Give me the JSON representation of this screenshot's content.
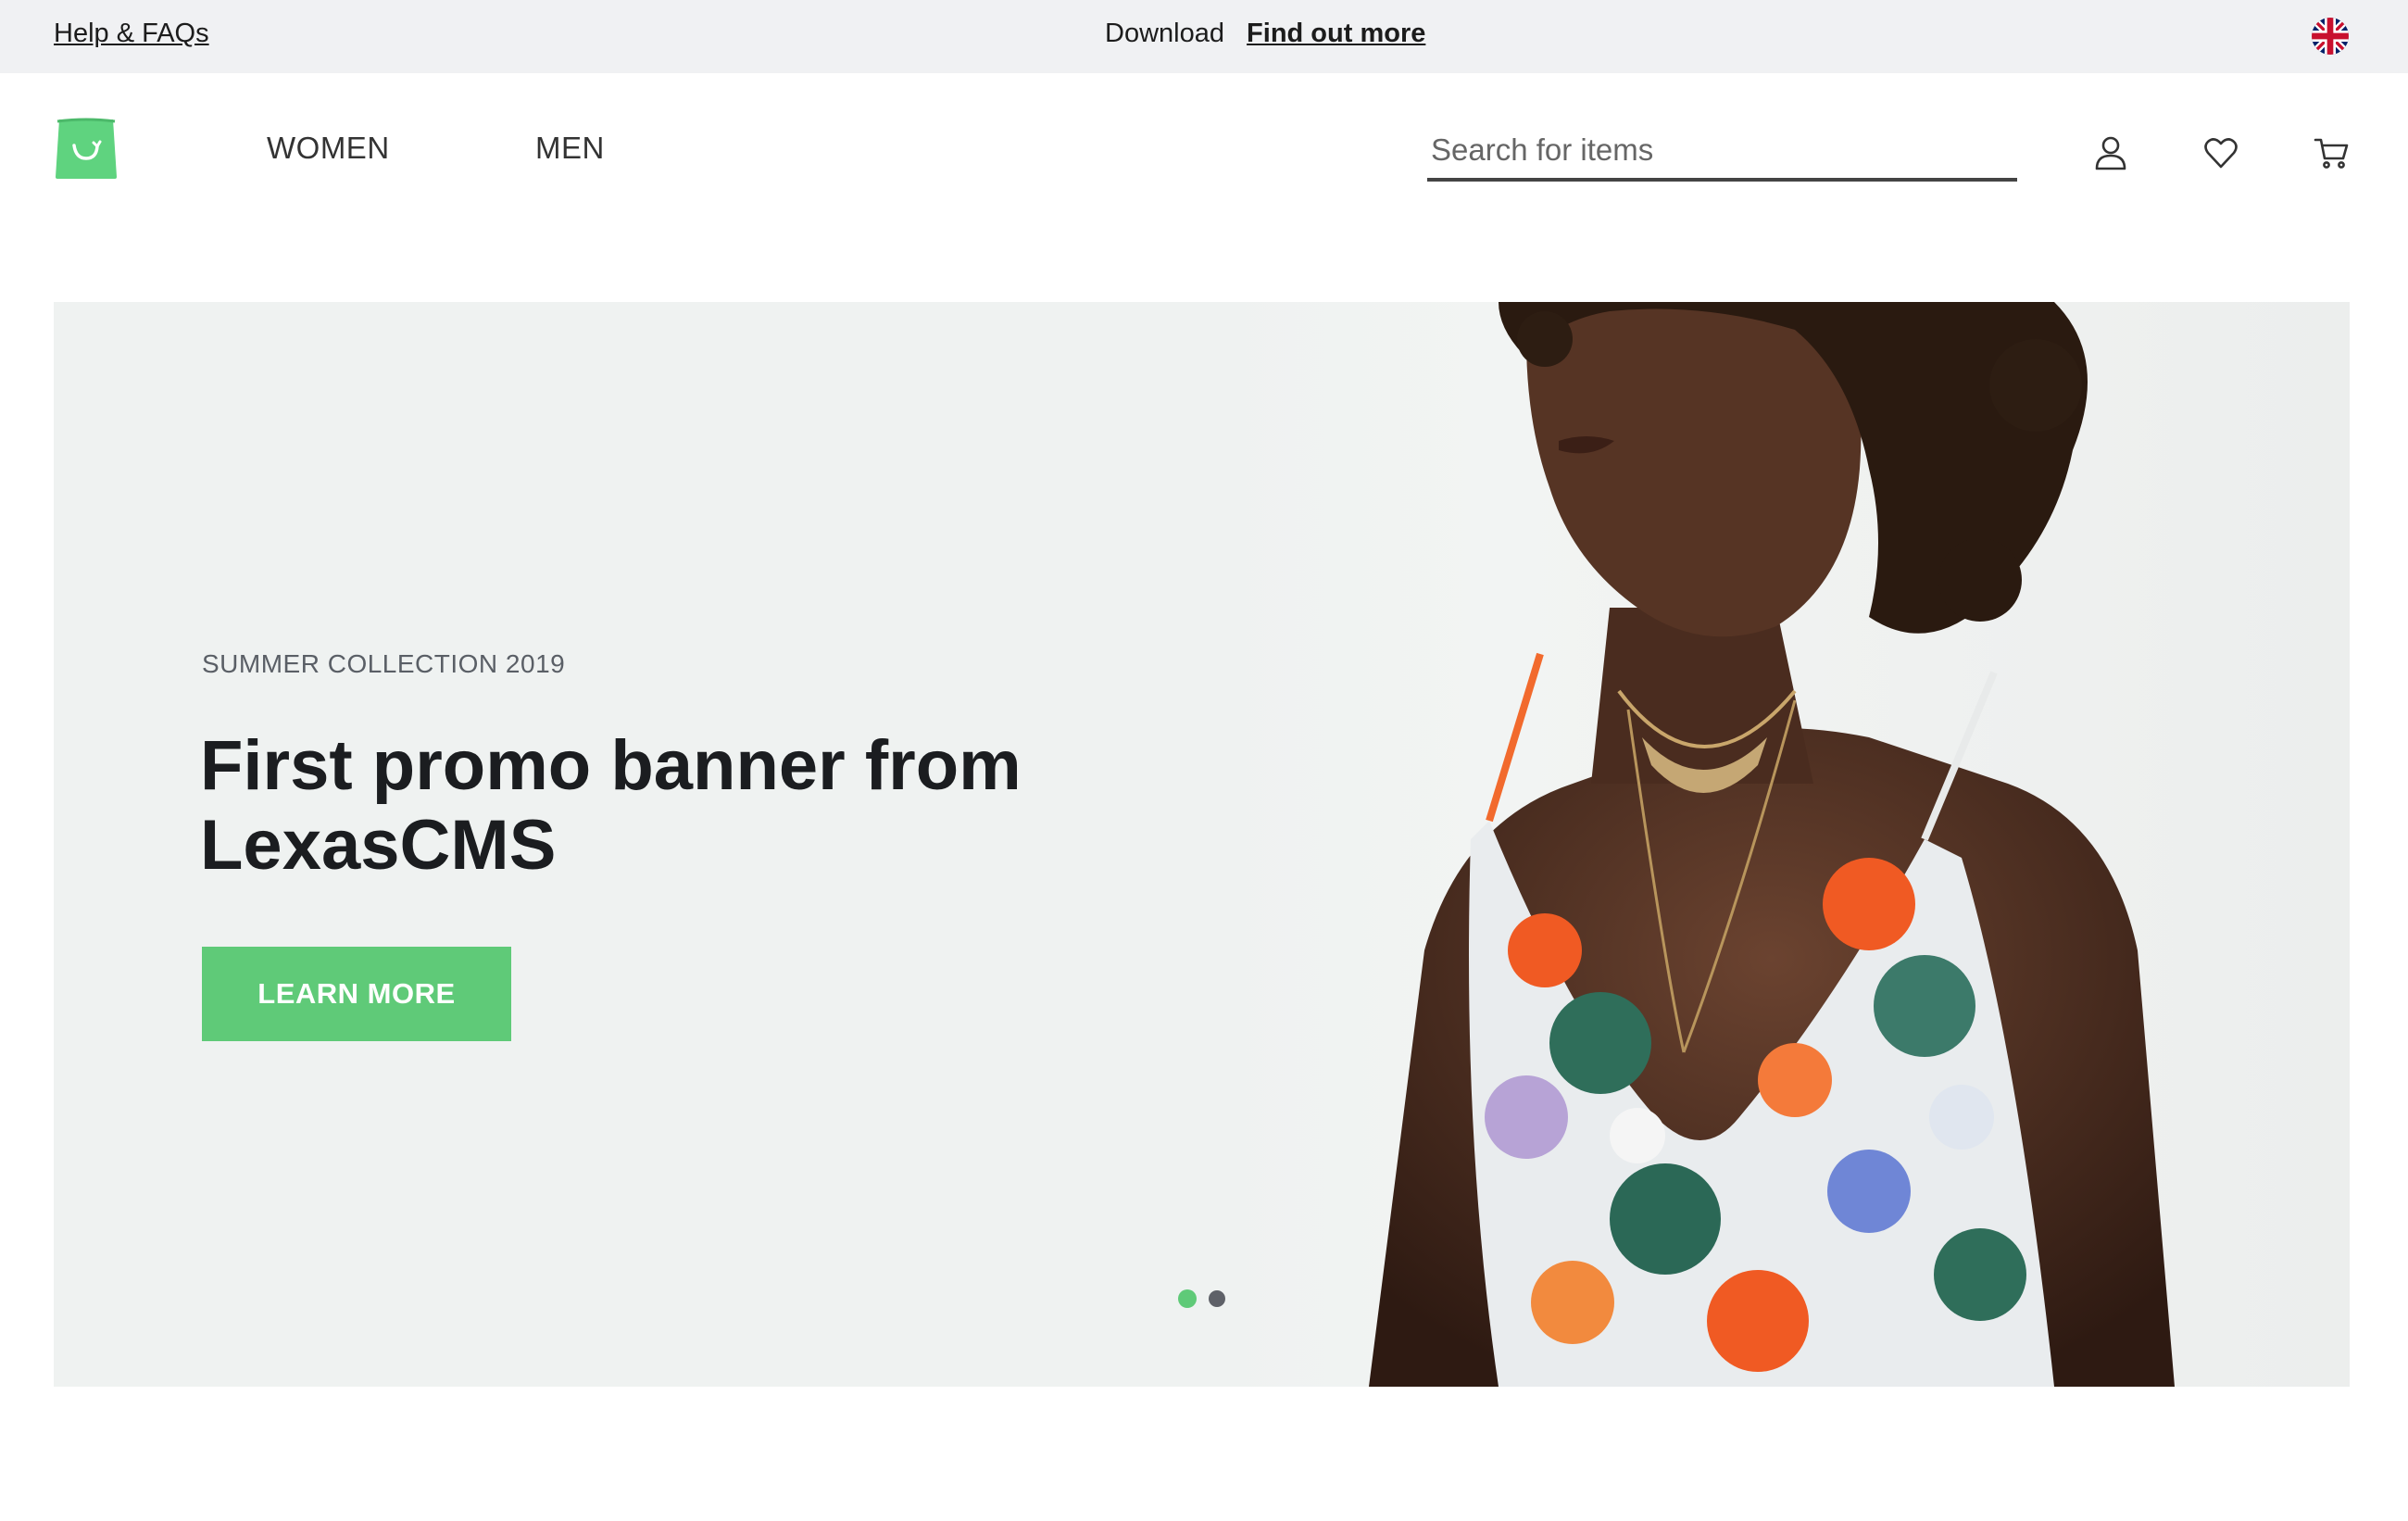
{
  "topbar": {
    "help_link": "Help & FAQs",
    "download_text": "Download",
    "find_out_more": "Find out more",
    "language_icon": "uk-flag-icon"
  },
  "header": {
    "logo_icon": "shopping-bag-logo-icon",
    "nav": {
      "women": "WOMEN",
      "men": "MEN"
    },
    "search": {
      "placeholder": "Search for items",
      "value": ""
    },
    "icons": [
      "user-icon",
      "heart-icon",
      "cart-icon"
    ]
  },
  "hero": {
    "eyebrow": "SUMMER COLLECTION 2019",
    "headline": "First promo banner from LexasCMS",
    "cta_label": "LEARN MORE",
    "slides_count": 2,
    "active_slide": 1
  },
  "colors": {
    "accent": "#5fca78",
    "topbar_bg": "#f0f1f3",
    "hero_bg": "#eff2f1",
    "text_dark": "#1b1d20"
  }
}
